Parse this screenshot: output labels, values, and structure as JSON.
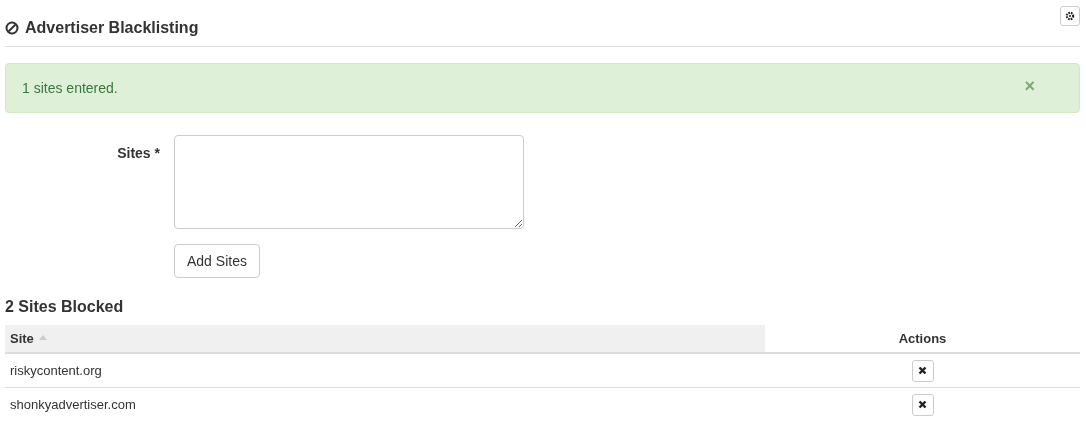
{
  "header": {
    "title": "Advertiser Blacklisting"
  },
  "alert": {
    "message": "1 sites entered.",
    "close": "×"
  },
  "form": {
    "label": "Sites *",
    "button": "Add Sites"
  },
  "table": {
    "title": "2 Sites Blocked",
    "columns": [
      {
        "label": "Site",
        "sorted": true
      },
      {
        "label": "Actions",
        "sorted": false
      }
    ],
    "rows": [
      {
        "site": "riskycontent.org"
      },
      {
        "site": "shonkyadvertiser.com"
      }
    ]
  }
}
